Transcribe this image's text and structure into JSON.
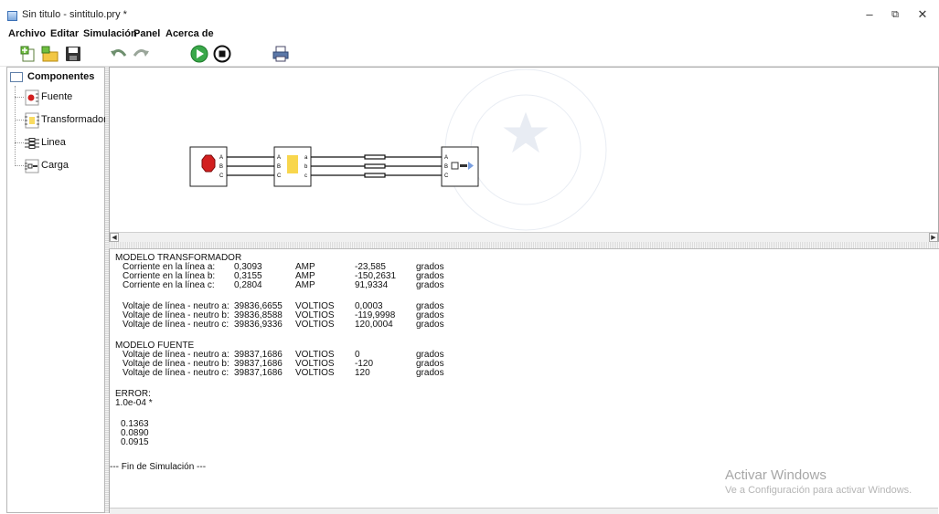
{
  "window": {
    "title": "Sin titulo - sintitulo.pry *",
    "controls": {
      "minimize": "–",
      "maximize": "⧉",
      "close": "✕"
    }
  },
  "menu": [
    "Archivo",
    "Editar",
    "Simulación",
    "Panel",
    "Acerca de"
  ],
  "toolbar": [
    {
      "name": "new-project-icon"
    },
    {
      "name": "open-folder-icon"
    },
    {
      "name": "save-icon"
    },
    {
      "name": "undo-icon"
    },
    {
      "name": "redo-icon"
    },
    {
      "name": "run-simulation-icon"
    },
    {
      "name": "stop-simulation-icon"
    },
    {
      "name": "print-icon"
    }
  ],
  "tree": {
    "root": "Componentes",
    "items": [
      {
        "label": "Fuente",
        "icon": "source-icon"
      },
      {
        "label": "Transformador",
        "icon": "transformer-icon"
      },
      {
        "label": "Linea",
        "icon": "line-icon"
      },
      {
        "label": "Carga",
        "icon": "load-icon"
      }
    ]
  },
  "diagram": {
    "terminals_in": [
      "A",
      "B",
      "C"
    ],
    "transformer_in": [
      "A",
      "B",
      "C"
    ],
    "transformer_out": [
      "a",
      "b",
      "c"
    ],
    "load_in": [
      "A",
      "B",
      "C"
    ]
  },
  "output": {
    "trafo_header": "MODELO TRANSFORMADOR",
    "trafo_currents": [
      {
        "label": "Corriente en la línea a:",
        "value": "0,3093",
        "unit": "AMP",
        "angle": "-23,585",
        "angle_unit": "grados"
      },
      {
        "label": "Corriente en la línea b:",
        "value": "0,3155",
        "unit": "AMP",
        "angle": "-150,2631",
        "angle_unit": "grados"
      },
      {
        "label": "Corriente en la línea c:",
        "value": "0,2804",
        "unit": "AMP",
        "angle": "91,9334",
        "angle_unit": "grados"
      }
    ],
    "trafo_voltages": [
      {
        "label": "Voltaje de línea - neutro a:",
        "value": "39836,6655",
        "unit": "VOLTIOS",
        "angle": "0,0003",
        "angle_unit": "grados"
      },
      {
        "label": "Voltaje de línea - neutro b:",
        "value": "39836,8588",
        "unit": "VOLTIOS",
        "angle": "-119,9998",
        "angle_unit": "grados"
      },
      {
        "label": "Voltaje de línea - neutro c:",
        "value": "39836,9336",
        "unit": "VOLTIOS",
        "angle": "120,0004",
        "angle_unit": "grados"
      }
    ],
    "source_header": "MODELO FUENTE",
    "source_voltages": [
      {
        "label": "Voltaje de línea - neutro a:",
        "value": "39837,1686",
        "unit": "VOLTIOS",
        "angle": "0",
        "angle_unit": "grados"
      },
      {
        "label": "Voltaje de línea - neutro b:",
        "value": "39837,1686",
        "unit": "VOLTIOS",
        "angle": "-120",
        "angle_unit": "grados"
      },
      {
        "label": "Voltaje de línea - neutro c:",
        "value": "39837,1686",
        "unit": "VOLTIOS",
        "angle": "120",
        "angle_unit": "grados"
      }
    ],
    "error_header": "ERROR:",
    "error_value": "1.0e-04 *",
    "error_values": [
      "0.1363",
      "0.0890",
      "0.0915"
    ],
    "end_text": "--- Fin de Simulación ---"
  },
  "watermark": {
    "title": "Activar Windows",
    "subtitle": "Ve a Configuración para activar Windows."
  }
}
